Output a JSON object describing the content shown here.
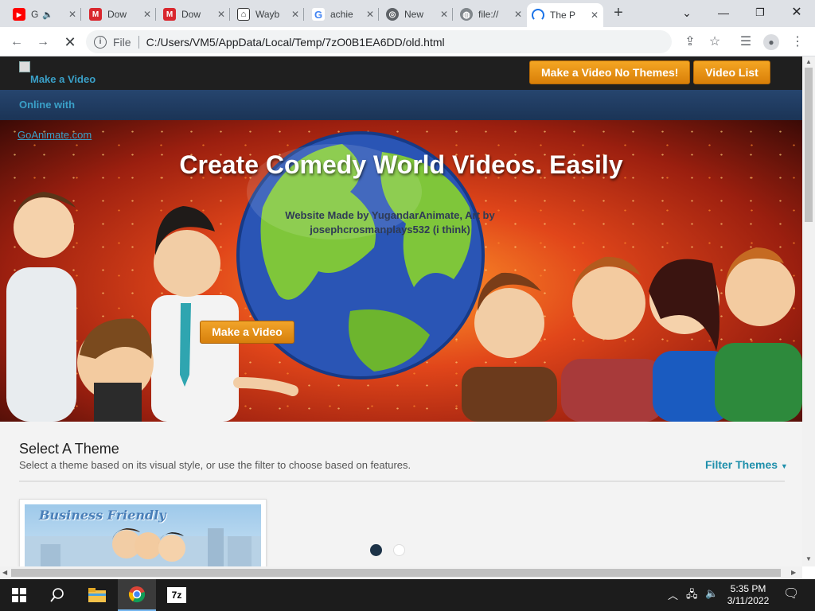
{
  "browser": {
    "tabs": [
      {
        "title": "G",
        "icon": "youtube-icon",
        "color": "#ff0000",
        "glyph": "▶",
        "audio": true
      },
      {
        "title": "Dow",
        "icon": "mega-icon",
        "color": "#d9272e",
        "glyph": "M"
      },
      {
        "title": "Dow",
        "icon": "mega-icon",
        "color": "#d9272e",
        "glyph": "M"
      },
      {
        "title": "Wayb",
        "icon": "wayback-icon",
        "color": "#333333",
        "glyph": "⌂"
      },
      {
        "title": "achie",
        "icon": "google-icon",
        "color": "#4285f4",
        "glyph": "G"
      },
      {
        "title": "New",
        "icon": "chrome-icon",
        "color": "#5f6368",
        "glyph": "◎"
      },
      {
        "title": "file://",
        "icon": "globe-icon",
        "color": "#80868b",
        "glyph": "◍"
      },
      {
        "title": "The P",
        "icon": "loading-spinner-icon",
        "color": "#1a73e8",
        "glyph": "◠",
        "active": true
      }
    ],
    "url_scheme": "File",
    "url": "C:/Users/VM5/AppData/Local/Temp/7zO0B1EA6DD/old.html"
  },
  "site": {
    "logo_alt": "Make a Video",
    "brand_line2": "Online with",
    "brand_line3": "GoAnimate.com",
    "nav": {
      "make_video_no_themes": "Make a Video No Themes!",
      "video_list": "Video List"
    },
    "hero": {
      "title": "Create Comedy World Videos. Easily",
      "credit": "Website Made by YugandarAnimate, Art by josephcrosmanplays532 (i think)",
      "cta": "Make a Video"
    },
    "themes": {
      "title": "Select A Theme",
      "subtitle": "Select a theme based on its visual style, or use the filter to choose based on features.",
      "filter_label": "Filter Themes",
      "cards": [
        {
          "name": "Business Friendly"
        }
      ],
      "carousel_active_index": 0
    }
  },
  "taskbar": {
    "time": "5:35 PM",
    "date": "3/11/2022",
    "apps": [
      {
        "icon": "file-explorer-icon"
      },
      {
        "icon": "chrome-icon",
        "active": true
      },
      {
        "icon": "7zip-icon",
        "label": "7z"
      }
    ]
  },
  "colors": {
    "accent_orange": "#e8930f",
    "link_teal": "#1e8fab",
    "header_dark": "#1f1f1f",
    "header_blue": "#1b3456"
  }
}
